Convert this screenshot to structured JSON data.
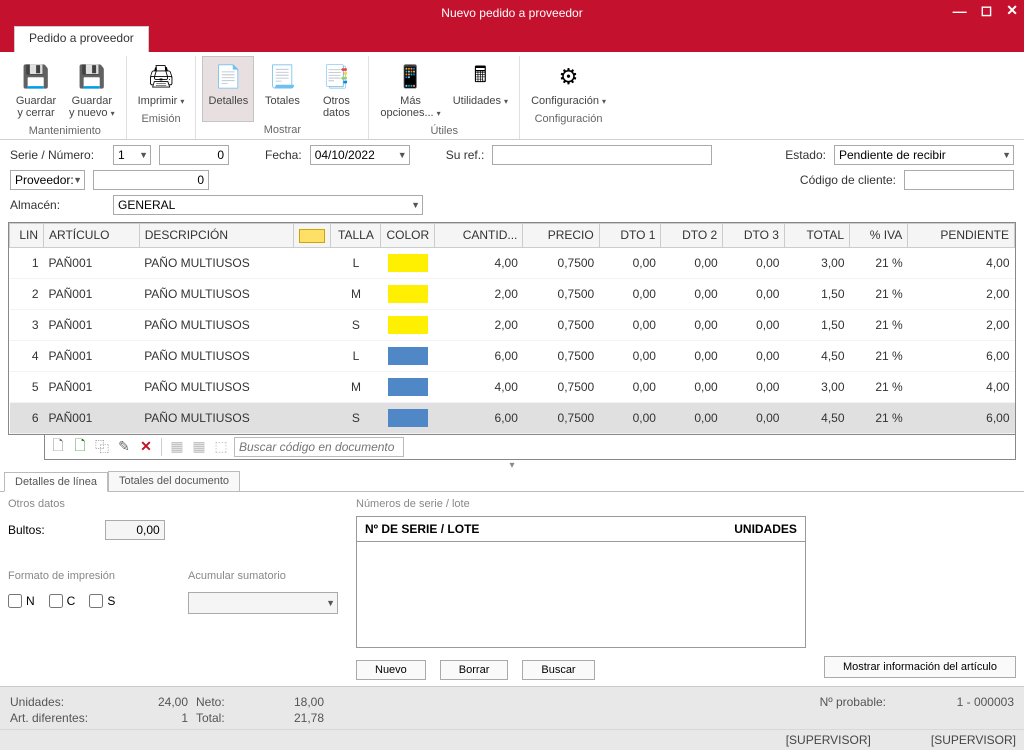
{
  "title": "Nuevo pedido a proveedor",
  "tab": "Pedido a proveedor",
  "ribbon": {
    "groups": [
      {
        "label": "Mantenimiento",
        "items": [
          {
            "id": "save-close",
            "label": "Guardar\ny cerrar",
            "glyph": "💾",
            "drop": false
          },
          {
            "id": "save-new",
            "label": "Guardar\ny nuevo",
            "glyph": "💾",
            "drop": true
          }
        ]
      },
      {
        "label": "Emisión",
        "items": [
          {
            "id": "print",
            "label": "Imprimir",
            "glyph": "🖨",
            "drop": true
          }
        ]
      },
      {
        "label": "Mostrar",
        "items": [
          {
            "id": "details",
            "label": "Detalles",
            "glyph": "📄",
            "active": true
          },
          {
            "id": "totals",
            "label": "Totales",
            "glyph": "📃"
          },
          {
            "id": "other",
            "label": "Otros\ndatos",
            "glyph": "📑"
          }
        ]
      },
      {
        "label": "Útiles",
        "items": [
          {
            "id": "more",
            "label": "Más\nopciones...",
            "glyph": "📱",
            "drop": true
          },
          {
            "id": "util",
            "label": "Utilidades",
            "glyph": "🖩",
            "drop": true
          }
        ]
      },
      {
        "label": "Configuración",
        "items": [
          {
            "id": "config",
            "label": "Configuración",
            "glyph": "⚙",
            "drop": true
          }
        ]
      }
    ]
  },
  "header": {
    "serie_label": "Serie / Número:",
    "serie": "1",
    "numero": "0",
    "fecha_label": "Fecha:",
    "fecha": "04/10/2022",
    "suref_label": "Su ref.:",
    "suref": "",
    "estado_label": "Estado:",
    "estado": "Pendiente de recibir",
    "proveedor_label": "Proveedor:",
    "proveedor_code": "0",
    "proveedor_name": "",
    "cod_cliente_label": "Código de cliente:",
    "cod_cliente": "",
    "almacen_label": "Almacén:",
    "almacen": "GENERAL"
  },
  "table": {
    "columns": [
      "LIN",
      "ARTÍCULO",
      "DESCRIPCIÓN",
      "",
      "TALLA",
      "COLOR",
      "CANTID...",
      "PRECIO",
      "DTO 1",
      "DTO 2",
      "DTO 3",
      "TOTAL",
      "% IVA",
      "PENDIENTE"
    ],
    "rows": [
      {
        "lin": "1",
        "art": "PAÑ001",
        "desc": "PAÑO MULTIUSOS",
        "talla": "L",
        "color": "yellow",
        "cant": "4,00",
        "precio": "0,7500",
        "d1": "0,00",
        "d2": "0,00",
        "d3": "0,00",
        "total": "3,00",
        "iva": "21 %",
        "pend": "4,00"
      },
      {
        "lin": "2",
        "art": "PAÑ001",
        "desc": "PAÑO MULTIUSOS",
        "talla": "M",
        "color": "yellow",
        "cant": "2,00",
        "precio": "0,7500",
        "d1": "0,00",
        "d2": "0,00",
        "d3": "0,00",
        "total": "1,50",
        "iva": "21 %",
        "pend": "2,00"
      },
      {
        "lin": "3",
        "art": "PAÑ001",
        "desc": "PAÑO MULTIUSOS",
        "talla": "S",
        "color": "yellow",
        "cant": "2,00",
        "precio": "0,7500",
        "d1": "0,00",
        "d2": "0,00",
        "d3": "0,00",
        "total": "1,50",
        "iva": "21 %",
        "pend": "2,00"
      },
      {
        "lin": "4",
        "art": "PAÑ001",
        "desc": "PAÑO MULTIUSOS",
        "talla": "L",
        "color": "blue",
        "cant": "6,00",
        "precio": "0,7500",
        "d1": "0,00",
        "d2": "0,00",
        "d3": "0,00",
        "total": "4,50",
        "iva": "21 %",
        "pend": "6,00"
      },
      {
        "lin": "5",
        "art": "PAÑ001",
        "desc": "PAÑO MULTIUSOS",
        "talla": "M",
        "color": "blue",
        "cant": "4,00",
        "precio": "0,7500",
        "d1": "0,00",
        "d2": "0,00",
        "d3": "0,00",
        "total": "3,00",
        "iva": "21 %",
        "pend": "4,00"
      },
      {
        "lin": "6",
        "art": "PAÑ001",
        "desc": "PAÑO MULTIUSOS",
        "talla": "S",
        "color": "blue",
        "cant": "6,00",
        "precio": "0,7500",
        "d1": "0,00",
        "d2": "0,00",
        "d3": "0,00",
        "total": "4,50",
        "iva": "21 %",
        "pend": "6,00",
        "selected": true
      }
    ],
    "search_placeholder": "Buscar código en documento"
  },
  "detail_tabs": {
    "t1": "Detalles de línea",
    "t2": "Totales del documento"
  },
  "otros": {
    "title": "Otros datos",
    "bultos_label": "Bultos:",
    "bultos": "0,00",
    "formato_label": "Formato de impresión",
    "n": "N",
    "c": "C",
    "s": "S",
    "acumular_label": "Acumular sumatorio"
  },
  "lote": {
    "title": "Números de serie / lote",
    "col1": "Nº DE SERIE / LOTE",
    "col2": "UNIDADES",
    "btn_new": "Nuevo",
    "btn_del": "Borrar",
    "btn_search": "Buscar"
  },
  "show_info_btn": "Mostrar información del artículo",
  "status": {
    "unidades_label": "Unidades:",
    "unidades": "24,00",
    "neto_label": "Neto:",
    "neto": "18,00",
    "artdif_label": "Art. diferentes:",
    "artdif": "1",
    "total_label": "Total:",
    "total": "21,78",
    "probable_label": "Nº probable:",
    "probable": "1 - 000003"
  },
  "footer": {
    "left": "[SUPERVISOR]",
    "right": "[SUPERVISOR]"
  }
}
